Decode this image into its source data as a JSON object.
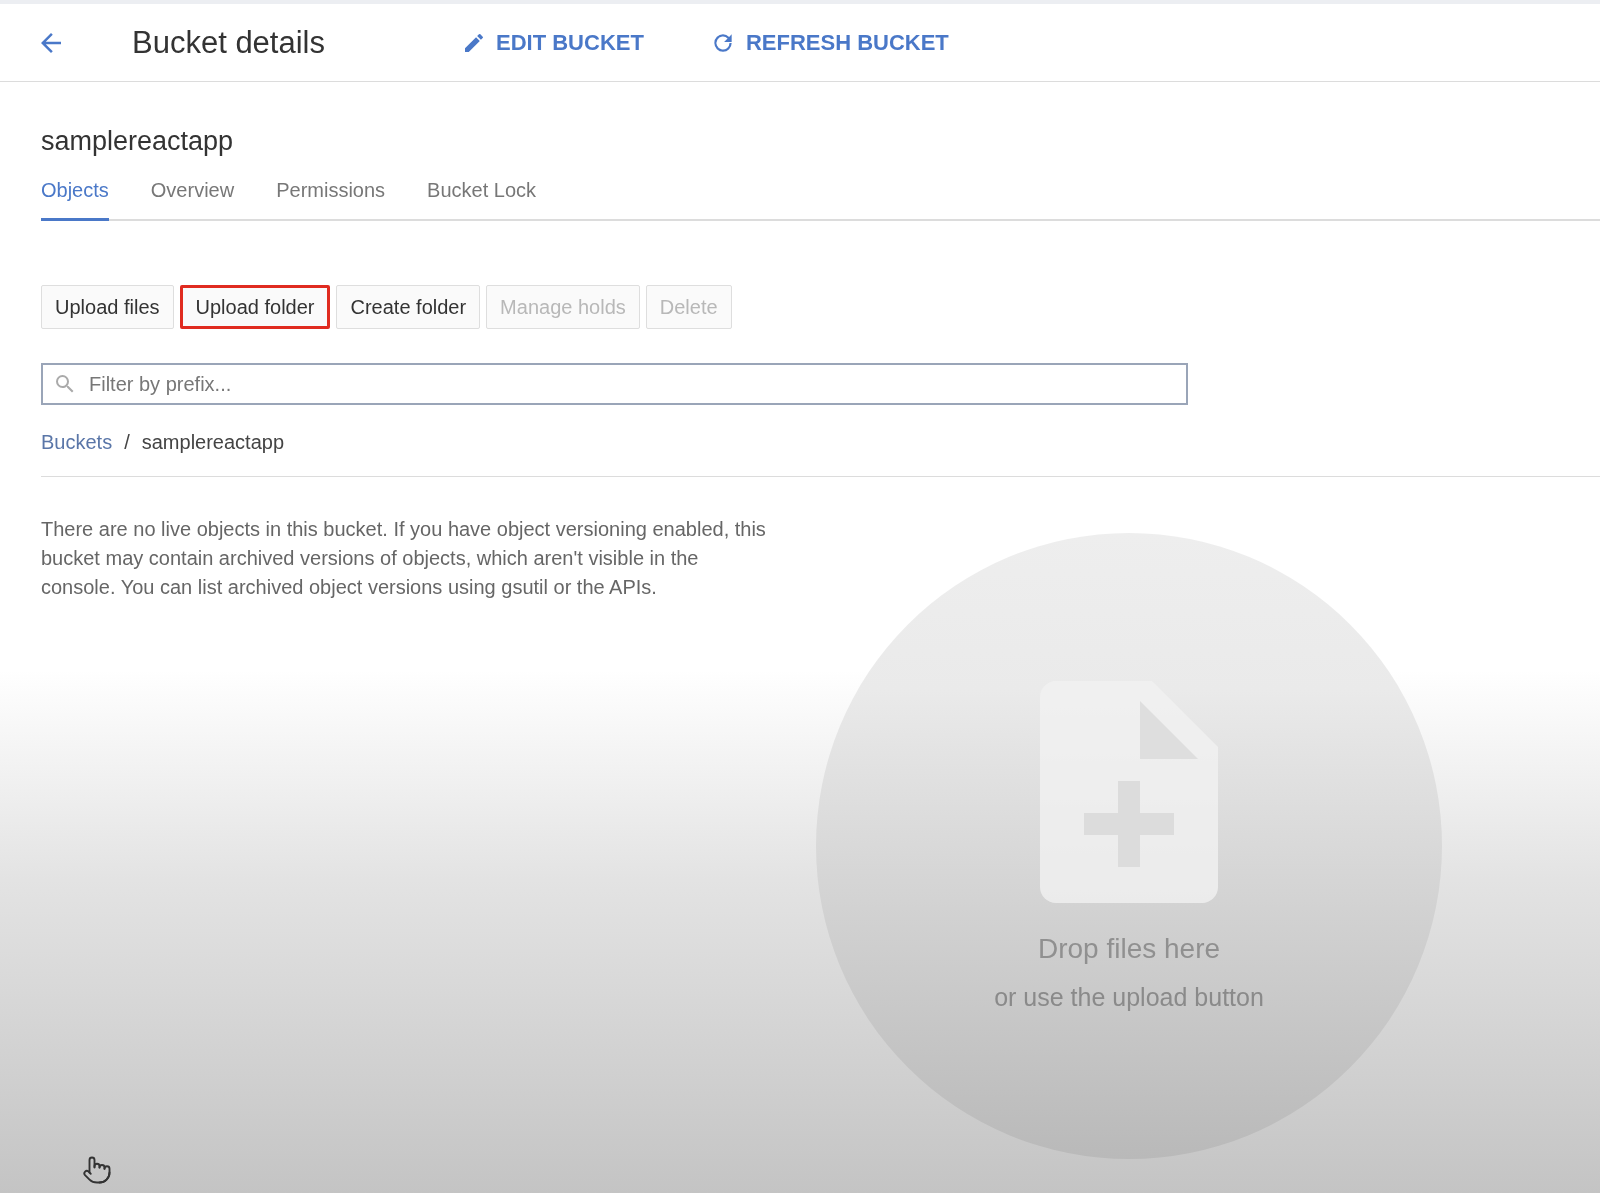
{
  "header": {
    "title": "Bucket details",
    "actions": [
      {
        "kind": "edit",
        "label": "EDIT BUCKET"
      },
      {
        "kind": "refresh",
        "label": "REFRESH BUCKET"
      }
    ]
  },
  "bucket": {
    "name": "samplereactapp"
  },
  "tabs": [
    {
      "label": "Objects",
      "selected": true
    },
    {
      "label": "Overview",
      "selected": false
    },
    {
      "label": "Permissions",
      "selected": false
    },
    {
      "label": "Bucket Lock",
      "selected": false
    }
  ],
  "buttons": [
    {
      "label": "Upload files",
      "disabled": false,
      "highlighted": false
    },
    {
      "label": "Upload folder",
      "disabled": false,
      "highlighted": true
    },
    {
      "label": "Create folder",
      "disabled": false,
      "highlighted": false
    },
    {
      "label": "Manage holds",
      "disabled": true,
      "highlighted": false
    },
    {
      "label": "Delete",
      "disabled": true,
      "highlighted": false
    }
  ],
  "filter": {
    "placeholder": "Filter by prefix..."
  },
  "breadcrumb": [
    {
      "label": "Buckets",
      "kind": "link"
    },
    {
      "label": "/",
      "kind": "separator"
    },
    {
      "label": "samplereactapp",
      "kind": "current"
    }
  ],
  "message": "There are no live objects in this bucket. If you have object versioning enabled, this bucket may contain archived versions of objects, which aren't visible in the console. You can list archived object versions using gsutil or the APIs.",
  "dropzone": {
    "title": "Drop files here",
    "subtitle": "or use the upload button"
  }
}
